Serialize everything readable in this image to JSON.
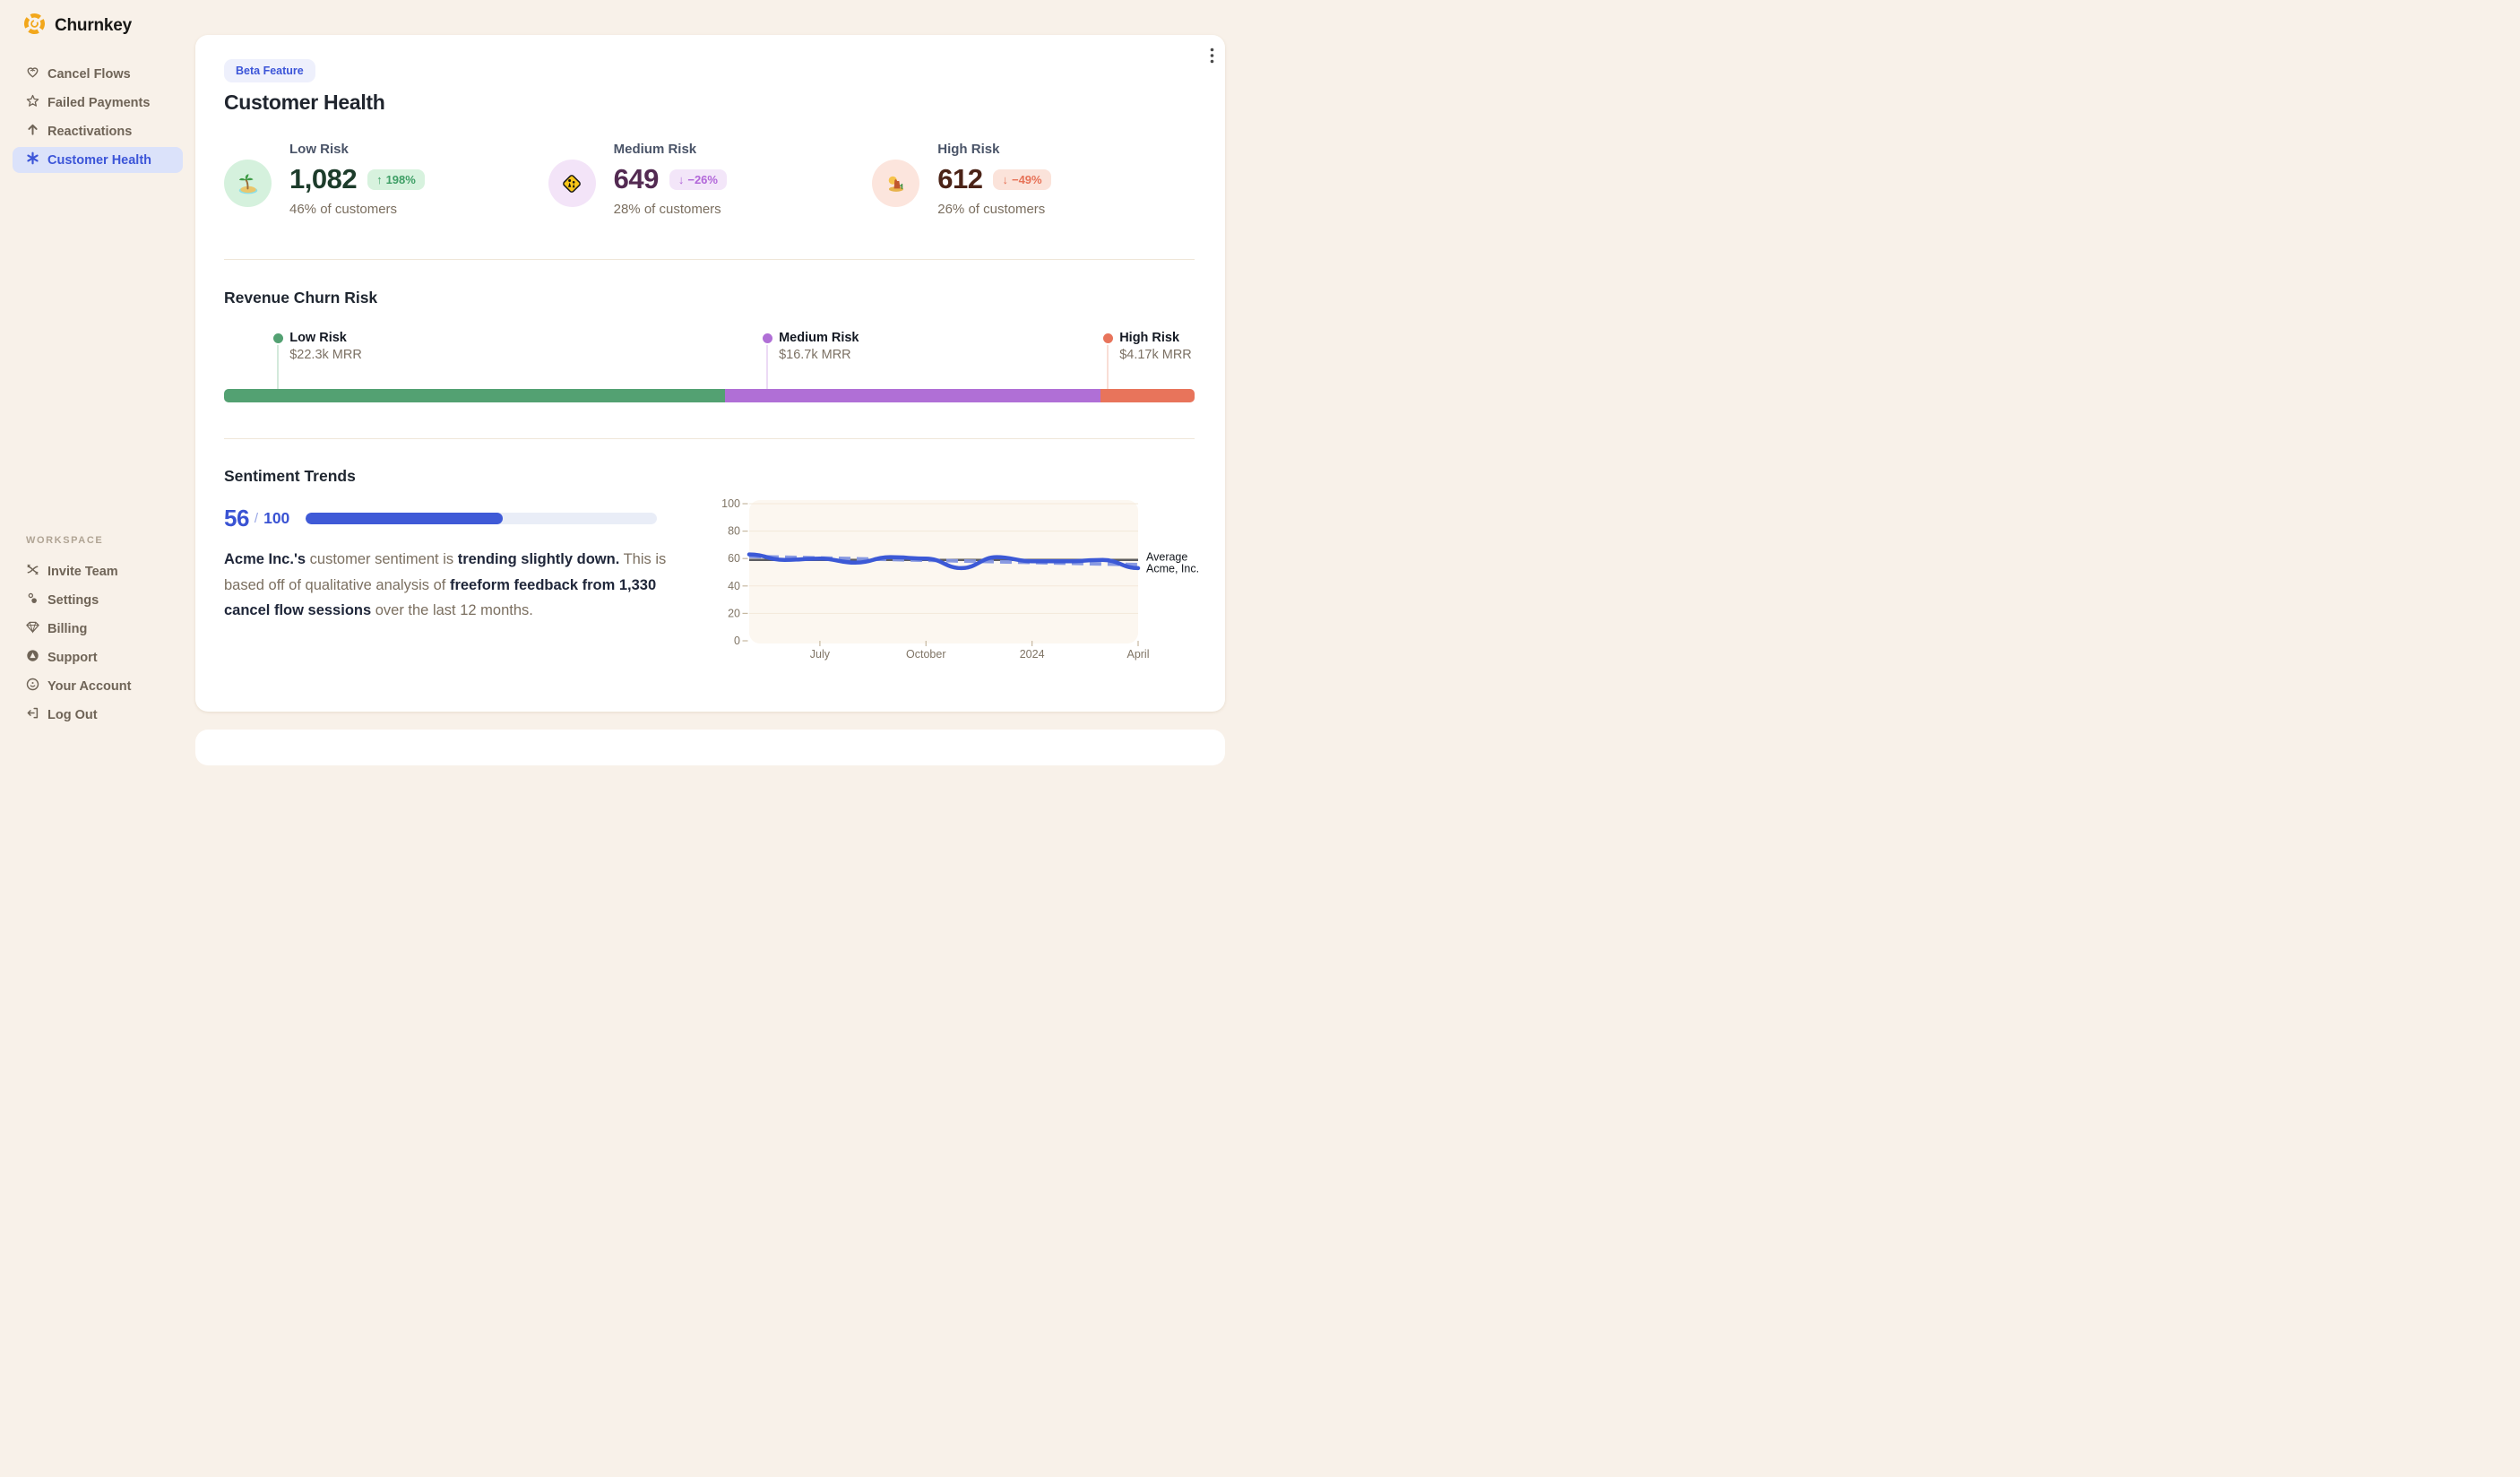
{
  "app": {
    "name": "Churnkey"
  },
  "sidebar": {
    "nav": [
      {
        "label": "Cancel Flows",
        "icon": "heart-icon",
        "active": false
      },
      {
        "label": "Failed Payments",
        "icon": "star-icon",
        "active": false
      },
      {
        "label": "Reactivations",
        "icon": "arrow-up-icon",
        "active": false
      },
      {
        "label": "Customer Health",
        "icon": "asterisk-icon",
        "active": true
      }
    ],
    "workspace_label": "WORKSPACE",
    "workspace": [
      {
        "label": "Invite Team",
        "icon": "shuffle-icon"
      },
      {
        "label": "Settings",
        "icon": "dots-icon"
      },
      {
        "label": "Billing",
        "icon": "gem-icon"
      },
      {
        "label": "Support",
        "icon": "lifebuoy-icon"
      },
      {
        "label": "Your Account",
        "icon": "account-icon"
      },
      {
        "label": "Log Out",
        "icon": "logout-icon"
      }
    ]
  },
  "header": {
    "badge": "Beta Feature",
    "title": "Customer Health",
    "menu_icon": "kebab-menu-icon"
  },
  "stats": [
    {
      "label": "Low Risk",
      "value": "1,082",
      "arrow": "↑",
      "delta": "198%",
      "pct": "46% of customers",
      "icon": "island-icon",
      "circle_bg": "#d5f1dd",
      "num_color": "#1d3c2b",
      "badge_bg": "#d7f2de",
      "badge_fg": "#3f9f66"
    },
    {
      "label": "Medium Risk",
      "value": "649",
      "arrow": "↓",
      "delta": "−26%",
      "pct": "28% of customers",
      "icon": "children-crossing-icon",
      "circle_bg": "#f3e4f8",
      "num_color": "#532a52",
      "badge_bg": "#f3e6f9",
      "badge_fg": "#b266d9"
    },
    {
      "label": "High Risk",
      "value": "612",
      "arrow": "↓",
      "delta": "−49%",
      "pct": "26% of customers",
      "icon": "desert-icon",
      "circle_bg": "#fce5dd",
      "num_color": "#4b2317",
      "badge_bg": "#fbe3da",
      "badge_fg": "#e77257"
    }
  ],
  "sentiment": {
    "title": "Sentiment Trends",
    "score": 56,
    "max": 100,
    "paragraph": [
      {
        "text": "Acme Inc.'s",
        "bold": true
      },
      {
        "text": " customer sentiment is ",
        "bold": false
      },
      {
        "text": "trending slightly down.",
        "bold": true
      },
      {
        "text": " This is based off of qualitative analysis of ",
        "bold": false
      },
      {
        "text": "freeform feedback from 1,330 cancel flow sessions",
        "bold": true
      },
      {
        "text": " over the last 12 months.",
        "bold": false
      }
    ]
  },
  "chart_data": [
    {
      "type": "line",
      "title": "Sentiment Trends",
      "n_points": 12,
      "series": [
        {
          "name": "Acme, Inc.",
          "values": [
            63,
            59,
            60,
            57,
            61,
            60,
            53,
            61,
            58,
            58,
            59,
            53
          ],
          "color": "#3c59d6",
          "style": "solid"
        }
      ],
      "average": 59,
      "average_color": "#5c5d61",
      "trend": [
        61.5,
        55.5
      ],
      "trend_color": "#8396e2",
      "ylim": [
        0,
        100
      ],
      "yticks": [
        0,
        20,
        40,
        60,
        80,
        100
      ],
      "x_labels": [
        "July",
        "October",
        "2024",
        "April"
      ],
      "x_label_indices": [
        2,
        5,
        8,
        11
      ],
      "right_labels": [
        "Average",
        "Acme, Inc."
      ],
      "plot_bg": "#fcf7f0",
      "grid_color": "#f3e9da",
      "axis_color": "#7f7465",
      "tick_color": "#c6b8a1",
      "label_color": "#15191f"
    },
    {
      "type": "stacked-bar",
      "title": "Revenue Churn Risk",
      "segments": [
        {
          "label": "Low Risk",
          "mrr": "$22.3k MRR",
          "color": "#53a172",
          "connector": "#d3e9db",
          "width_pct": 51.6,
          "marker_left_pct": 5.1
        },
        {
          "label": "Medium Risk",
          "mrr": "$16.7k MRR",
          "color": "#b06fd6",
          "connector": "#ecdaf5",
          "width_pct": 38.7,
          "marker_left_pct": 55.5
        },
        {
          "label": "High Risk",
          "mrr": "$4.17k MRR",
          "color": "#e8745b",
          "connector": "#f9ded6",
          "width_pct": 9.7,
          "marker_left_pct": 90.6
        }
      ]
    }
  ]
}
